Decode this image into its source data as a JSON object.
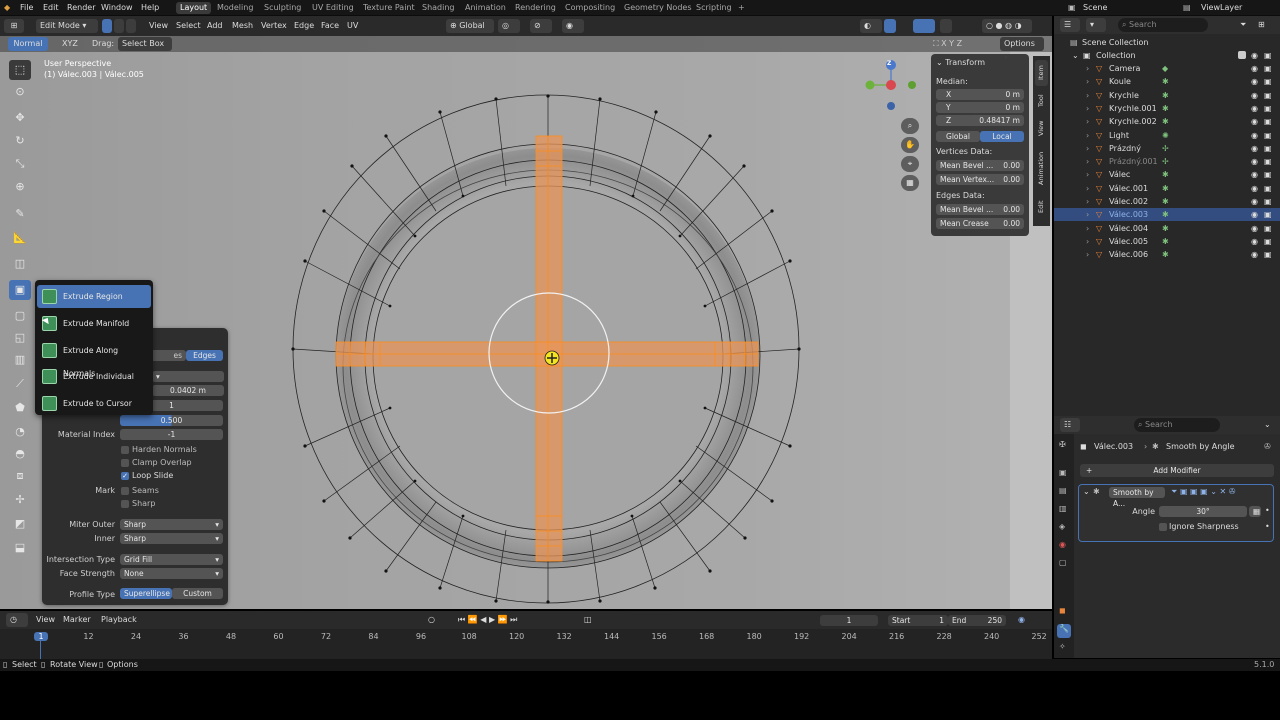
{
  "menu": [
    "File",
    "Edit",
    "Render",
    "Window",
    "Help"
  ],
  "workspaces": [
    "Layout",
    "Modeling",
    "Sculpting",
    "UV Editing",
    "Texture Paint",
    "Shading",
    "Animation",
    "Rendering",
    "Compositing",
    "Geometry Nodes",
    "Scripting"
  ],
  "workspace_add": "+",
  "scene": "Scene",
  "viewlayer": "ViewLayer",
  "header": {
    "mode": "Edit Mode",
    "menus": [
      "View",
      "Select",
      "Add",
      "Mesh",
      "Vertex",
      "Edge",
      "Face",
      "UV"
    ],
    "orientation": "Global",
    "options": "Options",
    "xyz": "X Y Z"
  },
  "header2": {
    "orientation": "Normal",
    "axis": "XYZ",
    "drag_label": "Drag:",
    "drag_value": "Select Box"
  },
  "viewport": {
    "line1": "User Perspective",
    "line2": "(1) Válec.003 | Válec.005"
  },
  "gizmo": {
    "z": "Z"
  },
  "flyout": [
    "Extrude Region",
    "Extrude Manifold",
    "Extrude Along Normals",
    "Extrude Individual",
    "Extrude to Cursor"
  ],
  "bevel": {
    "edges": "Edges",
    "tab_partial": "es",
    "amount": "0.0402 m",
    "segments": "1",
    "shape": "0.500",
    "material_index_label": "Material Index",
    "material_index": "-1",
    "harden_normals": "Harden Normals",
    "clamp_overlap": "Clamp Overlap",
    "loop_slide": "Loop Slide",
    "mark_label": "Mark",
    "seams": "Seams",
    "sharp_check": "Sharp",
    "miter_outer_label": "Miter Outer",
    "miter_outer": "Sharp",
    "inner_label": "Inner",
    "inner": "Sharp",
    "intersection_label": "Intersection Type",
    "intersection": "Grid Fill",
    "face_strength_label": "Face Strength",
    "face_strength": "None",
    "profile_label": "Profile Type",
    "profile_a": "Superellipse",
    "profile_b": "Custom"
  },
  "transform": {
    "title": "Transform",
    "median": "Median:",
    "x_label": "X",
    "x": "0 m",
    "y_label": "Y",
    "y": "0 m",
    "z_label": "Z",
    "z": "0.48417 m",
    "global": "Global",
    "local": "Local",
    "vertices_data": "Vertices Data:",
    "mean_bevel_v_label": "Mean Bevel ...",
    "mean_bevel_v": "0.00",
    "mean_vertex_label": "Mean Vertex...",
    "mean_vertex": "0.00",
    "edges_data": "Edges Data:",
    "mean_bevel_e_label": "Mean Bevel ...",
    "mean_bevel_e": "0.00",
    "mean_crease_label": "Mean Crease",
    "mean_crease": "0.00"
  },
  "side_tabs": [
    "Item",
    "Tool",
    "View",
    "Animation",
    "Edit"
  ],
  "outliner": {
    "search_placeholder": "Search",
    "root": "Scene Collection",
    "collection": "Collection",
    "items": [
      "Camera",
      "Koule",
      "Krychle",
      "Krychle.001",
      "Krychle.002",
      "Light",
      "Prázdný",
      "Prázdný.001",
      "Válec",
      "Válec.001",
      "Válec.002",
      "Válec.003",
      "Válec.004",
      "Válec.005",
      "Válec.006"
    ]
  },
  "properties": {
    "search_placeholder": "Search",
    "object": "Válec.003",
    "modifier_name": "Smooth by Angle",
    "add_modifier": "Add Modifier",
    "modifier_short": "Smooth by A...",
    "angle_label": "Angle",
    "angle": "30°",
    "ignore_sharpness": "Ignore Sharpness"
  },
  "timeline": {
    "menus": [
      "View",
      "Marker",
      "Playback"
    ],
    "frame": "1",
    "start_label": "Start",
    "start": "1",
    "end_label": "End",
    "end": "250",
    "ticks": [
      "1",
      "12",
      "24",
      "36",
      "48",
      "60",
      "72",
      "84",
      "96",
      "108",
      "120",
      "132",
      "144",
      "156",
      "168",
      "180",
      "192",
      "204",
      "216",
      "228",
      "240",
      "252"
    ]
  },
  "status": {
    "select": "Select",
    "rotate": "Rotate View",
    "options": "Options",
    "version": "5.1.0"
  },
  "colors": {
    "accent": "#4772b3",
    "selection": "#ff8c1a"
  }
}
